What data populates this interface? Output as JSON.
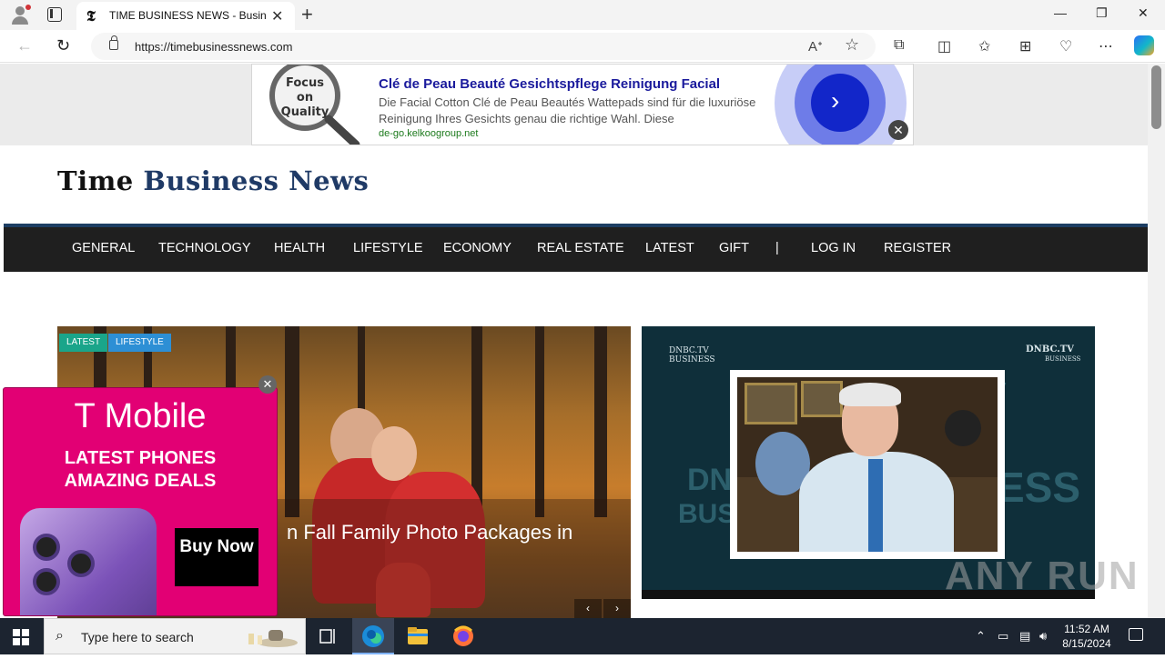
{
  "browser": {
    "tab_title": "TIME BUSINESS NEWS - Business",
    "tab_favicon": "𝕿",
    "new_tab": "+",
    "url": "https://timebusinessnews.com",
    "window": {
      "minimize": "—",
      "restore": "❐",
      "close": "✕"
    }
  },
  "top_ad": {
    "badge": "Focus on Quality",
    "title": "Clé de Peau Beauté Gesichtspflege Reinigung Facial",
    "description": "Die Facial Cotton Clé de Peau Beautés Wattepads sind für die luxuriöse Reinigung Ihres Gesichts genau die richtige Wahl. Diese",
    "url": "de-go.kelkoogroup.net",
    "close": "✕"
  },
  "site": {
    "logo_part1": "Time",
    "logo_part2": "Business News",
    "nav": [
      "GENERAL",
      "TECHNOLOGY",
      "HEALTH",
      "LIFESTYLE",
      "ECONOMY",
      "REAL ESTATE",
      "LATEST",
      "GIFT",
      "|",
      "LOG IN",
      "REGISTER"
    ]
  },
  "hero": {
    "badges": [
      "LATEST",
      "LIFESTYLE"
    ],
    "title_fragment": "n Fall Family Photo Packages in",
    "prev": "‹",
    "next": "›"
  },
  "video": {
    "label_left": "DNBC.TV BUSINESS",
    "label_right_1": "DNBC.TV",
    "label_right_2": "BUSINESS"
  },
  "tmobile_ad": {
    "brand": "T Mobile",
    "line1": "LATEST PHONES",
    "line2": "AMAZING DEALS",
    "button": "Buy Now",
    "close": "✕"
  },
  "watermark": "ANY RUN",
  "taskbar": {
    "search_placeholder": "Type here to search",
    "time": "11:52 AM",
    "date": "8/15/2024"
  },
  "colors": {
    "nav_bg": "#1f1f1f",
    "logo_blue": "#1f3a66",
    "badge_latest": "#1aa58a",
    "badge_lifestyle": "#2d8fd5",
    "tmobile_magenta": "#e20074"
  }
}
